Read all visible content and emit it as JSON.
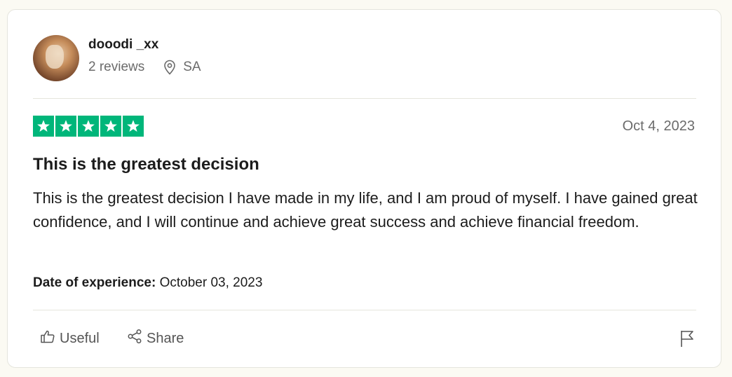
{
  "reviewer": {
    "name": "dooodi _xx",
    "reviews": "2 reviews",
    "country": "SA",
    "avatar_icon": "user-avatar-photo"
  },
  "review": {
    "rating": 5,
    "max_rating": 5,
    "star_color": "#00b67a",
    "date": "Oct 4, 2023",
    "title": "This is the greatest decision",
    "text": "This is the greatest decision I have made in my life, and I am proud of myself. I have gained great confidence, and I will continue and achieve great success and achieve financial freedom.",
    "experience_label": "Date of experience:",
    "experience_date": "October 03, 2023"
  },
  "actions": {
    "useful_label": "Useful",
    "share_label": "Share",
    "useful_icon": "thumbs-up-icon",
    "share_icon": "share-icon",
    "flag_icon": "flag-icon",
    "location_icon": "location-pin-icon"
  }
}
